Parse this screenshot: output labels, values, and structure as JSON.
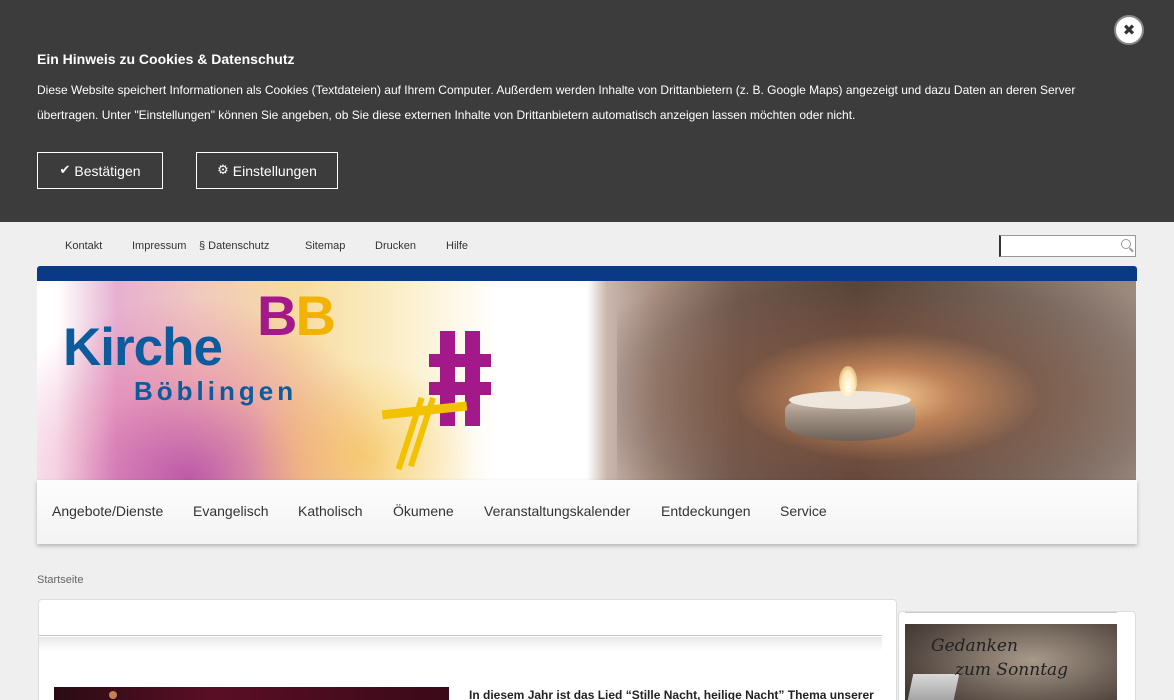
{
  "cookie": {
    "title": "Ein Hinweis zu Cookies & Datenschutz",
    "text": "Diese Website speichert Informationen als Cookies (Textdateien) auf Ihrem Computer. Außerdem werden Inhalte von Drittanbietern (z. B. Google Maps) angezeigt und dazu Daten an deren Server übertragen. Unter \"Einstellungen\" können Sie angeben, ob Sie diese externen Inhalte von Drittanbietern automatisch anzeigen lassen möchten oder nicht.",
    "confirm_label": "Bestätigen",
    "settings_label": "Einstellungen",
    "close_glyph": "✖"
  },
  "toplinks": {
    "kontakt": "Kontakt",
    "impressum": "Impressum",
    "datenschutz": "§ Datenschutz",
    "sitemap": "Sitemap",
    "drucken": "Drucken",
    "hilfe": "Hilfe"
  },
  "search": {
    "placeholder": ""
  },
  "logo": {
    "bb1": "B",
    "bb2": "B",
    "kirche": "Kirche",
    "city": "Böblingen"
  },
  "nav": [
    "Angebote/Dienste",
    "Evangelisch",
    "Katholisch",
    "Ökumene",
    "Veranstaltungskalender",
    "Entdeckungen",
    "Service"
  ],
  "breadcrumb": "Startseite",
  "content": {
    "teaser": "In diesem Jahr ist das Lied “Stille Nacht, heilige Nacht” Thema unserer"
  },
  "sidebar": {
    "image_line1": "Gedanken",
    "image_line2": "zum Sonntag"
  },
  "colors": {
    "banner_bar": "#0a3a86",
    "logo_blue": "#0c5b9c",
    "logo_purple": "#a3198a",
    "logo_yellow": "#f2b300",
    "cookie_bg": "#3c3c3c"
  }
}
